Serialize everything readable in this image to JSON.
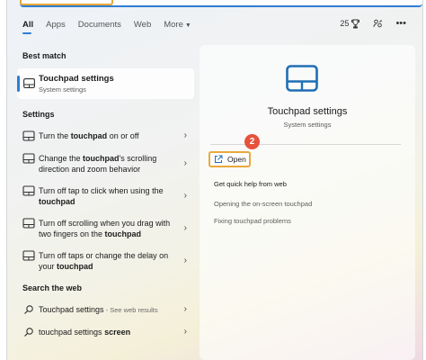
{
  "tabs": [
    {
      "label": "All",
      "active": true
    },
    {
      "label": "Apps"
    },
    {
      "label": "Documents"
    },
    {
      "label": "Web"
    },
    {
      "label": "More"
    }
  ],
  "top_right": {
    "points": "25"
  },
  "best_match": {
    "section": "Best match",
    "title": "Touchpad settings",
    "subtitle": "System settings"
  },
  "settings": {
    "section": "Settings",
    "items": [
      {
        "pre": "Turn the ",
        "bold": "touchpad",
        "post": " on or off"
      },
      {
        "pre": "Change the ",
        "bold": "touchpad",
        "post": "'s scrolling direction and zoom behavior"
      },
      {
        "pre": "Turn off tap to click when using the ",
        "bold": "touchpad",
        "post": ""
      },
      {
        "pre": "Turn off scrolling when you drag with two fingers on the ",
        "bold": "touchpad",
        "post": ""
      },
      {
        "pre": "Turn off taps or change the delay on your ",
        "bold": "touchpad",
        "post": ""
      }
    ]
  },
  "web": {
    "section": "Search the web",
    "items": [
      {
        "pre": "Touchpad settings",
        "muted": " - See web results",
        "bold": ""
      },
      {
        "pre": "touchpad settings ",
        "muted": "",
        "bold": "screen"
      }
    ]
  },
  "detail": {
    "title": "Touchpad settings",
    "subtitle": "System settings",
    "badge": "2",
    "open_label": "Open",
    "quick_help": "Get quick help from web",
    "links": [
      "Opening the on-screen touchpad",
      "Fixing touchpad problems"
    ]
  },
  "colors": {
    "accent": "#2f7dd1",
    "highlight": "#e8a93a",
    "badge": "#e5533d"
  }
}
